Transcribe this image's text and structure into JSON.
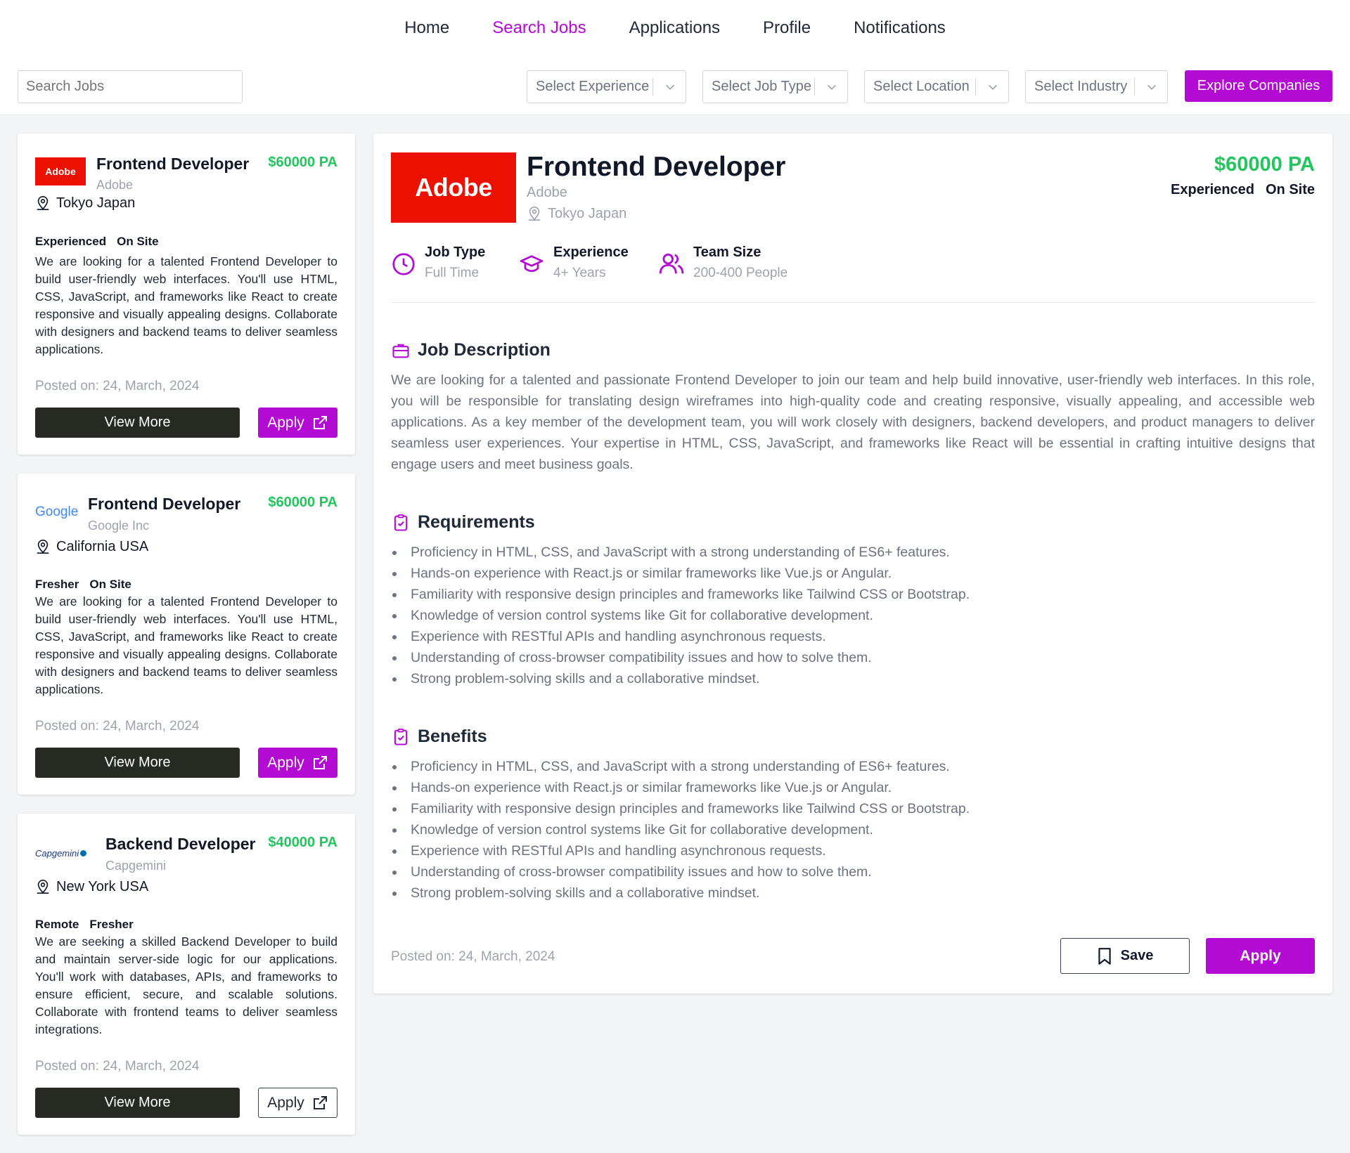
{
  "nav": {
    "items": [
      "Home",
      "Search Jobs",
      "Applications",
      "Profile",
      "Notifications"
    ],
    "active_index": 1
  },
  "filters": {
    "search_placeholder": "Search Jobs",
    "experience": "Select Experience",
    "job_type": "Select Job Type",
    "location": "Select Location",
    "industry": "Select Industry",
    "explore_label": "Explore Companies"
  },
  "jobs": [
    {
      "logo_text": "Adobe",
      "title": "Frontend Developer",
      "company": "Adobe",
      "salary": "$60000 PA",
      "location": "Tokyo Japan",
      "tags": [
        "Experienced",
        "On Site"
      ],
      "description": "We are looking for a talented Frontend Developer to build user-friendly web interfaces. You'll use HTML, CSS, JavaScript, and frameworks like React to create responsive and visually appealing designs. Collaborate with designers and backend teams to deliver seamless applications.",
      "posted": "Posted on: 24, March, 2024",
      "view_label": "View More",
      "apply_label": "Apply"
    },
    {
      "logo_text": "Google",
      "title": "Frontend Developer",
      "company": "Google Inc",
      "salary": "$60000 PA",
      "location": "California USA",
      "tags": [
        "Fresher",
        "On Site"
      ],
      "description": "We are looking for a talented Frontend Developer to build user-friendly web interfaces. You'll use HTML, CSS, JavaScript, and frameworks like React to create responsive and visually appealing designs. Collaborate with designers and backend teams to deliver seamless applications.",
      "posted": "Posted on: 24, March, 2024",
      "view_label": "View More",
      "apply_label": "Apply"
    },
    {
      "logo_text": "Capgemini",
      "title": "Backend Developer",
      "company": "Capgemini",
      "salary": "$40000 PA",
      "location": "New York USA",
      "tags": [
        "Remote",
        "Fresher"
      ],
      "description": "We are seeking a skilled Backend Developer to build and maintain server-side logic for our applications. You'll work with databases, APIs, and frameworks to ensure efficient, secure, and scalable solutions. Collaborate with frontend teams to deliver seamless integrations.",
      "posted": "Posted on: 24, March, 2024",
      "view_label": "View More",
      "apply_label": "Apply"
    }
  ],
  "detail": {
    "logo_text": "Adobe",
    "title": "Frontend Developer",
    "company": "Adobe",
    "location": "Tokyo Japan",
    "salary": "$60000 PA",
    "tags": [
      "Experienced",
      "On Site"
    ],
    "meta": [
      {
        "label": "Job Type",
        "value": "Full Time",
        "icon": "clock-icon"
      },
      {
        "label": "Experience",
        "value": "4+ Years",
        "icon": "graduation-cap-icon"
      },
      {
        "label": "Team Size",
        "value": "200-400 People",
        "icon": "users-icon"
      }
    ],
    "description_heading": "Job Description",
    "description": "We are looking for a talented and passionate Frontend Developer to join our team and help build innovative, user-friendly web interfaces. In this role, you will be responsible for translating design wireframes into high-quality code and creating responsive, visually appealing, and accessible web applications. As a key member of the development team, you will work closely with designers, backend developers, and product managers to deliver seamless user experiences. Your expertise in HTML, CSS, JavaScript, and frameworks like React will be essential in crafting intuitive designs that engage users and meet business goals.",
    "requirements_heading": "Requirements",
    "requirements": [
      "Proficiency in HTML, CSS, and JavaScript with a strong understanding of ES6+ features.",
      "Hands-on experience with React.js or similar frameworks like Vue.js or Angular.",
      "Familiarity with responsive design principles and frameworks like Tailwind CSS or Bootstrap.",
      "Knowledge of version control systems like Git for collaborative development.",
      "Experience with RESTful APIs and handling asynchronous requests.",
      "Understanding of cross-browser compatibility issues and how to solve them.",
      "Strong problem-solving skills and a collaborative mindset."
    ],
    "benefits_heading": "Benefits",
    "benefits": [
      "Proficiency in HTML, CSS, and JavaScript with a strong understanding of ES6+ features.",
      "Hands-on experience with React.js or similar frameworks like Vue.js or Angular.",
      "Familiarity with responsive design principles and frameworks like Tailwind CSS or Bootstrap.",
      "Knowledge of version control systems like Git for collaborative development.",
      "Experience with RESTful APIs and handling asynchronous requests.",
      "Understanding of cross-browser compatibility issues and how to solve them.",
      "Strong problem-solving skills and a collaborative mindset."
    ],
    "posted": "Posted on: 24, March, 2024",
    "save_label": "Save",
    "apply_label": "Apply"
  },
  "colors": {
    "accent": "#b30bd3",
    "salary_green": "#22c55e",
    "dark_button": "#262a23",
    "adobe_red": "#eb1000"
  }
}
